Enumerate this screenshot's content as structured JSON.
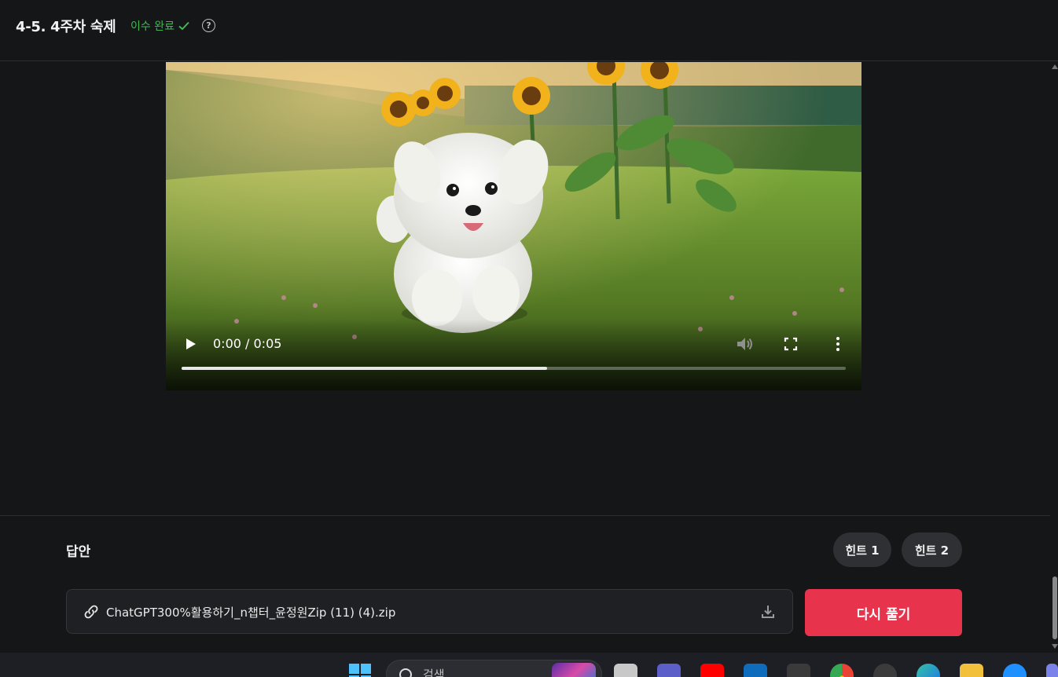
{
  "header": {
    "title": "4-5. 4주차 숙제",
    "status": "이수 완료",
    "help_glyph": "?"
  },
  "video": {
    "time": "0:00 / 0:05",
    "progress_fraction": 0.55
  },
  "answer": {
    "label": "답안",
    "hint1": "힌트 1",
    "hint2": "힌트 2",
    "file_name": "ChatGPT300%활용하기_n챕터_윤정원Zip (11) (4).zip",
    "retry_label": "다시 풀기"
  },
  "taskbar": {
    "search_placeholder": "검색"
  },
  "colors": {
    "background": "#151618",
    "accent_red": "#e8334d",
    "status_green": "#3fb950",
    "hint_bg": "#2e3034"
  }
}
